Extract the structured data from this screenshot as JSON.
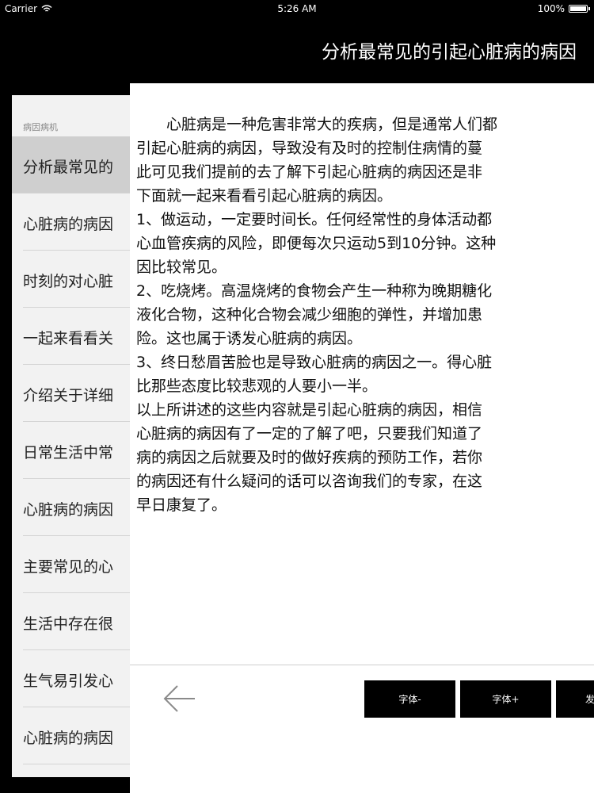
{
  "status_bar": {
    "carrier": "Carrier",
    "time": "5:26 AM",
    "battery": "100%",
    "battery_level": 1.0
  },
  "header": {
    "title": "分析最常见的引起心脏病的病因"
  },
  "sidebar": {
    "section_label": "病因病机",
    "items": [
      {
        "label": "分析最常见的",
        "selected": true
      },
      {
        "label": "心脏病的病因"
      },
      {
        "label": "时刻的对心脏"
      },
      {
        "label": "一起来看看关"
      },
      {
        "label": "介绍关于详细"
      },
      {
        "label": "日常生活中常"
      },
      {
        "label": "心脏病的病因"
      },
      {
        "label": "主要常见的心"
      },
      {
        "label": "生活中存在很"
      },
      {
        "label": "生气易引发心"
      },
      {
        "label": "心脏病的病因"
      }
    ]
  },
  "article": {
    "paragraphs": [
      {
        "lines": [
          "心脏病是一种危害非常大的疾病，但是通常人们都",
          "引起心脏病的病因，导致没有及时的控制住病情的蔓",
          "此可见我们提前的去了解下引起心脏病的病因还是非",
          "下面就一起来看看引起心脏病的病因。"
        ]
      },
      {
        "lines": [
          "1、做运动，一定要时间长。任何经常性的身体活动都",
          "心血管疾病的风险，即便每次只运动5到10分钟。这种",
          "因比较常见。"
        ]
      },
      {
        "lines": [
          "2、吃烧烤。高温烧烤的食物会产生一种称为晚期糖化",
          "液化合物，这种化合物会减少细胞的弹性，并增加患",
          "险。这也属于诱发心脏病的病因。"
        ]
      },
      {
        "lines": [
          "3、终日愁眉苦脸也是导致心脏病的病因之一。得心脏",
          "比那些态度比较悲观的人要小一半。"
        ]
      },
      {
        "lines": [
          "以上所讲述的这些内容就是引起心脏病的病因，相信",
          "心脏病的病因有了一定的了解了吧，只要我们知道了",
          "病的病因之后就要及时的做好疾病的预防工作，若你",
          "的病因还有什么疑问的话可以咨询我们的专家，在这",
          "早日康复了。"
        ]
      }
    ]
  },
  "toolbar": {
    "back_icon": "left-arrow-icon",
    "font_decrease": "字体-",
    "font_increase": "字体+",
    "third": "发"
  }
}
